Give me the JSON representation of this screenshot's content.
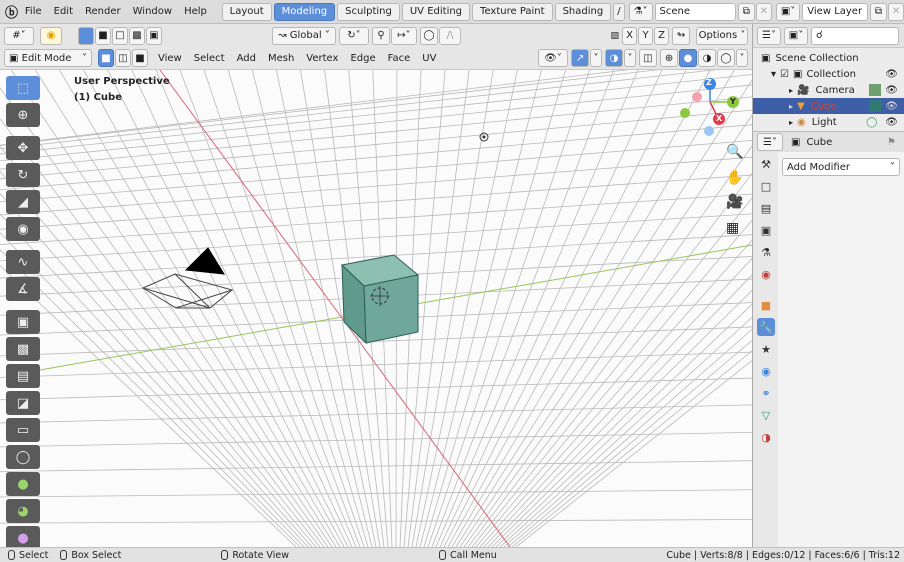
{
  "menubar": {
    "items": [
      "File",
      "Edit",
      "Render",
      "Window",
      "Help"
    ],
    "workspaces": [
      "Layout",
      "Modeling",
      "Sculpting",
      "UV Editing",
      "Texture Paint",
      "Shading"
    ],
    "active_workspace": "Modeling",
    "scene_label": "Scene",
    "view_layer_label": "View Layer"
  },
  "header1": {
    "transform_orientation": "Global",
    "axes": [
      "X",
      "Y",
      "Z"
    ],
    "options_label": "Options"
  },
  "header2": {
    "mode": "Edit Mode",
    "menus": [
      "View",
      "Select",
      "Add",
      "Mesh",
      "Vertex",
      "Edge",
      "Face",
      "UV"
    ]
  },
  "viewport": {
    "view_name": "User Perspective",
    "object_name": "(1) Cube",
    "gizmo_axes": [
      "X",
      "Y",
      "Z"
    ]
  },
  "outliner": {
    "scene_collection": "Scene Collection",
    "collection": "Collection",
    "items": [
      {
        "name": "Camera",
        "icon": "camera-icon"
      },
      {
        "name": "Cube",
        "icon": "mesh-icon"
      },
      {
        "name": "Light",
        "icon": "light-icon"
      }
    ]
  },
  "properties": {
    "object_name": "Cube",
    "add_modifier_label": "Add Modifier",
    "active_tab": "modifier-tab"
  },
  "statusbar": {
    "select": "Select",
    "box_select": "Box Select",
    "rotate_view": "Rotate View",
    "call_menu": "Call Menu",
    "stats": "Cube | Verts:8/8 | Edges:0/12 | Faces:6/6 | Tris:12"
  },
  "colors": {
    "accent": "#5d8ed9",
    "cube_face": "#6fa89a",
    "axis_x": "#e03c4f",
    "axis_y": "#8bc83c",
    "axis_z": "#3a86e8"
  }
}
